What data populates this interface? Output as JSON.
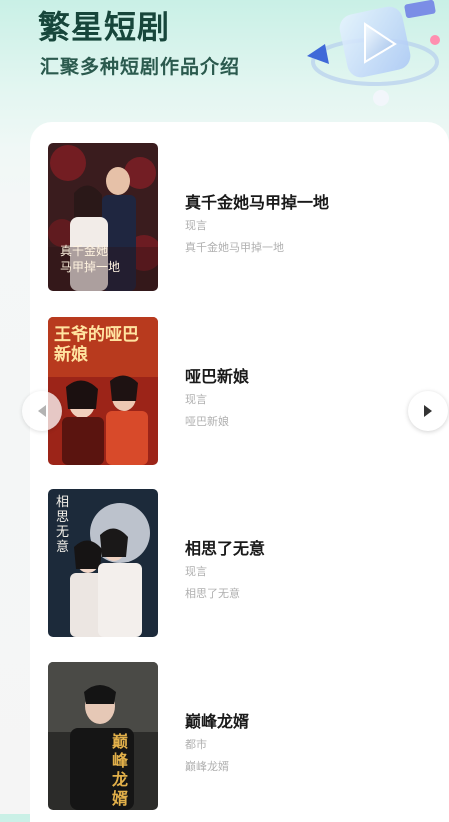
{
  "header": {
    "title": "繁星短剧",
    "subtitle": "汇聚多种短剧作品介绍"
  },
  "colors": {
    "brand_dark": "#17463b",
    "header_gradient_top": "#c9f0e6",
    "secondary_text": "#b0b0b0"
  },
  "dramas": [
    {
      "title": "真千金她马甲掉一地",
      "genre": "现言",
      "desc": "真千金她马甲掉一地",
      "poster_text": "真千金她 马甲掉一地"
    },
    {
      "title": "哑巴新娘",
      "genre": "现言",
      "desc": "哑巴新娘",
      "poster_text": "王爷的哑巴新娘"
    },
    {
      "title": "相思了无意",
      "genre": "现言",
      "desc": "相思了无意",
      "poster_text": "相思无意"
    },
    {
      "title": "巅峰龙婿",
      "genre": "都市",
      "desc": "巅峰龙婿",
      "poster_text": "巅峰龙婿"
    }
  ],
  "nav": {
    "prev_icon": "chevron-left-icon",
    "next_icon": "chevron-right-icon"
  }
}
